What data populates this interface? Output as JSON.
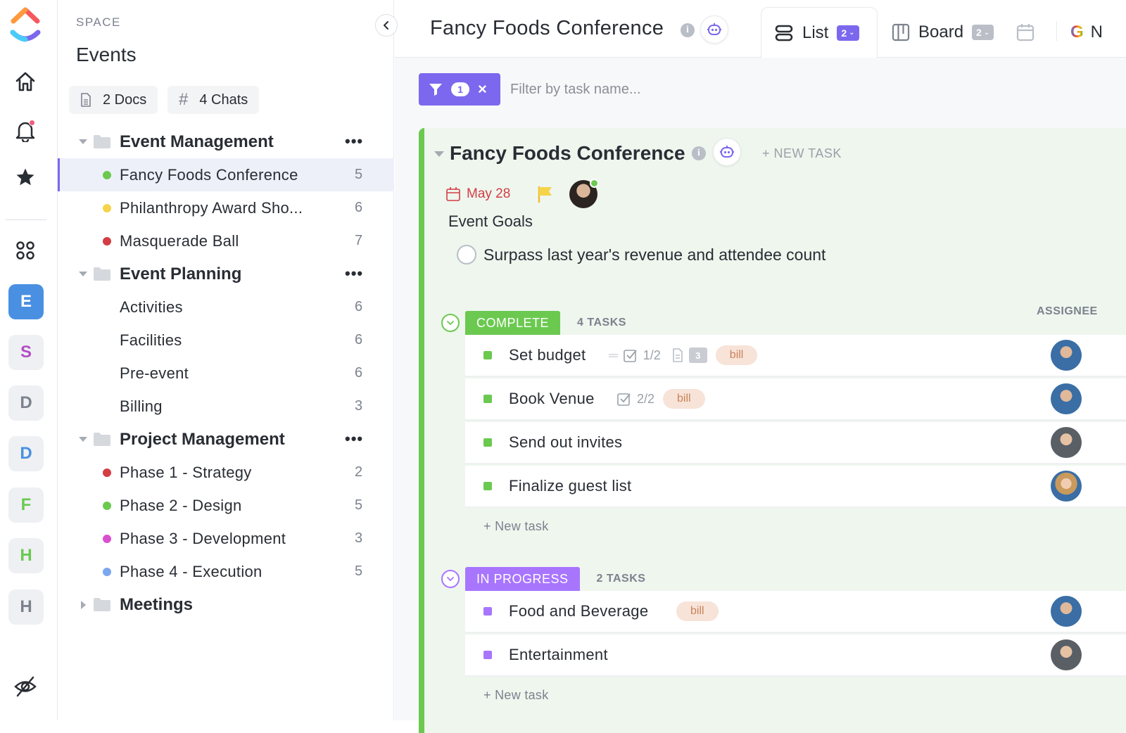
{
  "space": {
    "label": "SPACE",
    "title": "Events",
    "docs_chip": "2 Docs",
    "chats_chip": "4 Chats"
  },
  "rail": {
    "workspaces": [
      "E",
      "S",
      "D",
      "D",
      "F",
      "H",
      "H"
    ],
    "workspace_colors": [
      "#4a90e2",
      "#b44dc4",
      "#7c828d",
      "#4a90e2",
      "#6bc950",
      "#6bc950",
      "#7c828d"
    ]
  },
  "tree": [
    {
      "type": "folder",
      "name": "Event Management",
      "open": true,
      "dots": "•••"
    },
    {
      "type": "list",
      "name": "Fancy Foods Conference",
      "count": "5",
      "color": "#6bc950",
      "active": true
    },
    {
      "type": "list",
      "name": "Philanthropy Award Sho...",
      "count": "6",
      "color": "#f5d44b"
    },
    {
      "type": "list",
      "name": "Masquerade Ball",
      "count": "7",
      "color": "#d33d44"
    },
    {
      "type": "folder",
      "name": "Event Planning",
      "open": true,
      "dots": "•••"
    },
    {
      "type": "list",
      "name": "Activities",
      "count": "6",
      "color": ""
    },
    {
      "type": "list",
      "name": "Facilities",
      "count": "6",
      "color": ""
    },
    {
      "type": "list",
      "name": "Pre-event",
      "count": "6",
      "color": ""
    },
    {
      "type": "list",
      "name": "Billing",
      "count": "3",
      "color": ""
    },
    {
      "type": "folder",
      "name": "Project Management",
      "open": true,
      "dots": "•••"
    },
    {
      "type": "list",
      "name": "Phase 1 - Strategy",
      "count": "2",
      "color": "#d33d44"
    },
    {
      "type": "list",
      "name": "Phase 2 - Design",
      "count": "5",
      "color": "#6bc950"
    },
    {
      "type": "list",
      "name": "Phase 3 - Development",
      "count": "3",
      "color": "#d94fd0"
    },
    {
      "type": "list",
      "name": "Phase 4 - Execution",
      "count": "5",
      "color": "#7ba7f0"
    },
    {
      "type": "folder",
      "name": "Meetings",
      "open": false,
      "dots": ""
    }
  ],
  "header": {
    "title": "Fancy Foods Conference",
    "info": "i",
    "tabs": [
      {
        "label": "List",
        "badge": "2",
        "active": true
      },
      {
        "label": "Board",
        "badge": "2",
        "active": false
      }
    ],
    "partial_tab": "N"
  },
  "filter": {
    "count": "1",
    "placeholder": "Filter by task name..."
  },
  "list": {
    "title": "Fancy Foods Conference",
    "new_task": "+ NEW TASK",
    "due_date": "May 28",
    "description_title": "Event Goals",
    "goal": "Surpass last year's revenue and attendee count",
    "assignee_header": "ASSIGNEE",
    "groups": [
      {
        "status": "COMPLETE",
        "color": "#6bc950",
        "count_label": "4 TASKS",
        "new_task": "+ New task",
        "tasks": [
          {
            "name": "Set budget",
            "checklist": "1/2",
            "doc_count": "3",
            "tag": "bill"
          },
          {
            "name": "Book Venue",
            "checklist": "2/2",
            "tag": "bill"
          },
          {
            "name": "Send out invites"
          },
          {
            "name": "Finalize guest list"
          }
        ]
      },
      {
        "status": "IN PROGRESS",
        "color": "#a875ff",
        "count_label": "2 TASKS",
        "new_task": "+ New task",
        "tasks": [
          {
            "name": "Food and Beverage",
            "tag": "bill"
          },
          {
            "name": "Entertainment"
          }
        ]
      }
    ]
  }
}
